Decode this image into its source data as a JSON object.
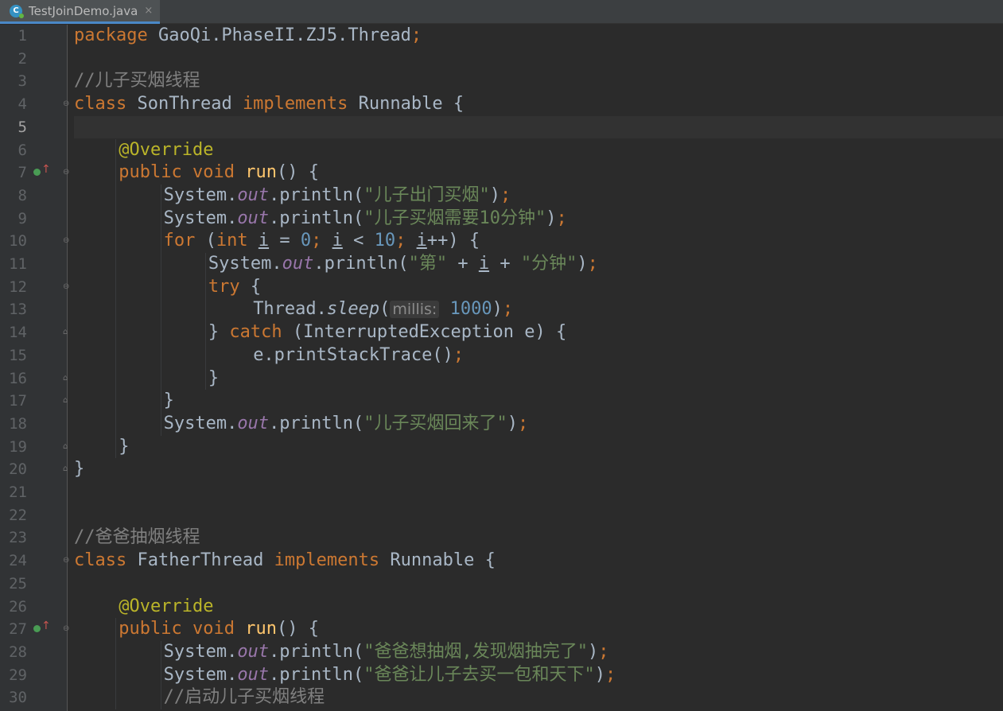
{
  "tab": {
    "title": "TestJoinDemo.java",
    "close": "×",
    "icon_letter": "C"
  },
  "editor": {
    "current_line": 5,
    "lines": [
      {
        "n": "1",
        "indent": 0,
        "fold": "",
        "ovr": false,
        "tokens": [
          [
            "kw",
            "package"
          ],
          [
            "pl",
            " GaoQi.PhaseII.ZJ5.Thread"
          ],
          [
            "kw",
            ";"
          ]
        ]
      },
      {
        "n": "2",
        "indent": 0,
        "fold": "",
        "ovr": false,
        "tokens": []
      },
      {
        "n": "3",
        "indent": 0,
        "fold": "",
        "ovr": false,
        "tokens": [
          [
            "com",
            "//儿子买烟线程"
          ]
        ]
      },
      {
        "n": "4",
        "indent": 0,
        "fold": "open",
        "ovr": false,
        "tokens": [
          [
            "kw",
            "class"
          ],
          [
            "pl",
            " SonThread "
          ],
          [
            "kw",
            "implements"
          ],
          [
            "pl",
            " Runnable {"
          ]
        ]
      },
      {
        "n": "5",
        "indent": 0,
        "fold": "",
        "ovr": false,
        "tokens": []
      },
      {
        "n": "6",
        "indent": 1,
        "fold": "",
        "ovr": false,
        "tokens": [
          [
            "ann",
            "@Override"
          ]
        ]
      },
      {
        "n": "7",
        "indent": 1,
        "fold": "open",
        "ovr": true,
        "tokens": [
          [
            "kw",
            "public void"
          ],
          [
            "pl",
            " "
          ],
          [
            "fn",
            "run"
          ],
          [
            "pl",
            "() {"
          ]
        ]
      },
      {
        "n": "8",
        "indent": 2,
        "fold": "",
        "ovr": false,
        "tokens": [
          [
            "pl",
            "System."
          ],
          [
            "fld",
            "out"
          ],
          [
            "pl",
            ".println("
          ],
          [
            "str",
            "\"儿子出门买烟\""
          ],
          [
            "pl",
            ")"
          ],
          [
            "kw",
            ";"
          ]
        ]
      },
      {
        "n": "9",
        "indent": 2,
        "fold": "",
        "ovr": false,
        "tokens": [
          [
            "pl",
            "System."
          ],
          [
            "fld",
            "out"
          ],
          [
            "pl",
            ".println("
          ],
          [
            "str",
            "\"儿子买烟需要10分钟\""
          ],
          [
            "pl",
            ")"
          ],
          [
            "kw",
            ";"
          ]
        ]
      },
      {
        "n": "10",
        "indent": 2,
        "fold": "open",
        "ovr": false,
        "tokens": [
          [
            "kw",
            "for"
          ],
          [
            "pl",
            " ("
          ],
          [
            "kw",
            "int"
          ],
          [
            "pl",
            " "
          ],
          [
            "ulpl",
            "i"
          ],
          [
            "pl",
            " = "
          ],
          [
            "num",
            "0"
          ],
          [
            "kw",
            ";"
          ],
          [
            "pl",
            " "
          ],
          [
            "ulpl",
            "i"
          ],
          [
            "pl",
            " < "
          ],
          [
            "num",
            "10"
          ],
          [
            "kw",
            ";"
          ],
          [
            "pl",
            " "
          ],
          [
            "ulpl",
            "i"
          ],
          [
            "pl",
            "++) {"
          ]
        ]
      },
      {
        "n": "11",
        "indent": 3,
        "fold": "",
        "ovr": false,
        "tokens": [
          [
            "pl",
            "System."
          ],
          [
            "fld",
            "out"
          ],
          [
            "pl",
            ".println("
          ],
          [
            "str",
            "\"第\""
          ],
          [
            "pl",
            " + "
          ],
          [
            "ulpl",
            "i"
          ],
          [
            "pl",
            " + "
          ],
          [
            "str",
            "\"分钟\""
          ],
          [
            "pl",
            ")"
          ],
          [
            "kw",
            ";"
          ]
        ]
      },
      {
        "n": "12",
        "indent": 3,
        "fold": "open",
        "ovr": false,
        "tokens": [
          [
            "kw",
            "try"
          ],
          [
            "pl",
            " {"
          ]
        ]
      },
      {
        "n": "13",
        "indent": 4,
        "fold": "",
        "ovr": false,
        "tokens": [
          [
            "pl",
            "Thread."
          ],
          [
            "st",
            "sleep"
          ],
          [
            "pl",
            "("
          ],
          [
            "hint",
            "millis:"
          ],
          [
            "pl",
            " "
          ],
          [
            "num",
            "1000"
          ],
          [
            "pl",
            ")"
          ],
          [
            "kw",
            ";"
          ]
        ]
      },
      {
        "n": "14",
        "indent": 3,
        "fold": "close",
        "ovr": false,
        "tokens": [
          [
            "pl",
            "} "
          ],
          [
            "kw",
            "catch"
          ],
          [
            "pl",
            " (InterruptedException e) {"
          ]
        ]
      },
      {
        "n": "15",
        "indent": 4,
        "fold": "",
        "ovr": false,
        "tokens": [
          [
            "pl",
            "e.printStackTrace()"
          ],
          [
            "kw",
            ";"
          ]
        ]
      },
      {
        "n": "16",
        "indent": 3,
        "fold": "close",
        "ovr": false,
        "tokens": [
          [
            "pl",
            "}"
          ]
        ]
      },
      {
        "n": "17",
        "indent": 2,
        "fold": "close",
        "ovr": false,
        "tokens": [
          [
            "pl",
            "}"
          ]
        ]
      },
      {
        "n": "18",
        "indent": 2,
        "fold": "",
        "ovr": false,
        "tokens": [
          [
            "pl",
            "System."
          ],
          [
            "fld",
            "out"
          ],
          [
            "pl",
            ".println("
          ],
          [
            "str",
            "\"儿子买烟回来了\""
          ],
          [
            "pl",
            ")"
          ],
          [
            "kw",
            ";"
          ]
        ]
      },
      {
        "n": "19",
        "indent": 1,
        "fold": "close",
        "ovr": false,
        "tokens": [
          [
            "pl",
            "}"
          ]
        ]
      },
      {
        "n": "20",
        "indent": 0,
        "fold": "close",
        "ovr": false,
        "tokens": [
          [
            "pl",
            "}"
          ]
        ]
      },
      {
        "n": "21",
        "indent": 0,
        "fold": "",
        "ovr": false,
        "tokens": []
      },
      {
        "n": "22",
        "indent": 0,
        "fold": "",
        "ovr": false,
        "tokens": []
      },
      {
        "n": "23",
        "indent": 0,
        "fold": "",
        "ovr": false,
        "tokens": [
          [
            "com",
            "//爸爸抽烟线程"
          ]
        ]
      },
      {
        "n": "24",
        "indent": 0,
        "fold": "open",
        "ovr": false,
        "tokens": [
          [
            "kw",
            "class"
          ],
          [
            "pl",
            " FatherThread "
          ],
          [
            "kw",
            "implements"
          ],
          [
            "pl",
            " Runnable {"
          ]
        ]
      },
      {
        "n": "25",
        "indent": 0,
        "fold": "",
        "ovr": false,
        "tokens": []
      },
      {
        "n": "26",
        "indent": 1,
        "fold": "",
        "ovr": false,
        "tokens": [
          [
            "ann",
            "@Override"
          ]
        ]
      },
      {
        "n": "27",
        "indent": 1,
        "fold": "open",
        "ovr": true,
        "tokens": [
          [
            "kw",
            "public void"
          ],
          [
            "pl",
            " "
          ],
          [
            "fn",
            "run"
          ],
          [
            "pl",
            "() {"
          ]
        ]
      },
      {
        "n": "28",
        "indent": 2,
        "fold": "",
        "ovr": false,
        "tokens": [
          [
            "pl",
            "System."
          ],
          [
            "fld",
            "out"
          ],
          [
            "pl",
            ".println("
          ],
          [
            "str",
            "\"爸爸想抽烟,发现烟抽完了\""
          ],
          [
            "pl",
            ")"
          ],
          [
            "kw",
            ";"
          ]
        ]
      },
      {
        "n": "29",
        "indent": 2,
        "fold": "",
        "ovr": false,
        "tokens": [
          [
            "pl",
            "System."
          ],
          [
            "fld",
            "out"
          ],
          [
            "pl",
            ".println("
          ],
          [
            "str",
            "\"爸爸让儿子去买一包和天下\""
          ],
          [
            "pl",
            ")"
          ],
          [
            "kw",
            ";"
          ]
        ]
      },
      {
        "n": "30",
        "indent": 2,
        "fold": "",
        "ovr": false,
        "tokens": [
          [
            "com",
            "//启动儿子买烟线程"
          ]
        ]
      }
    ]
  }
}
